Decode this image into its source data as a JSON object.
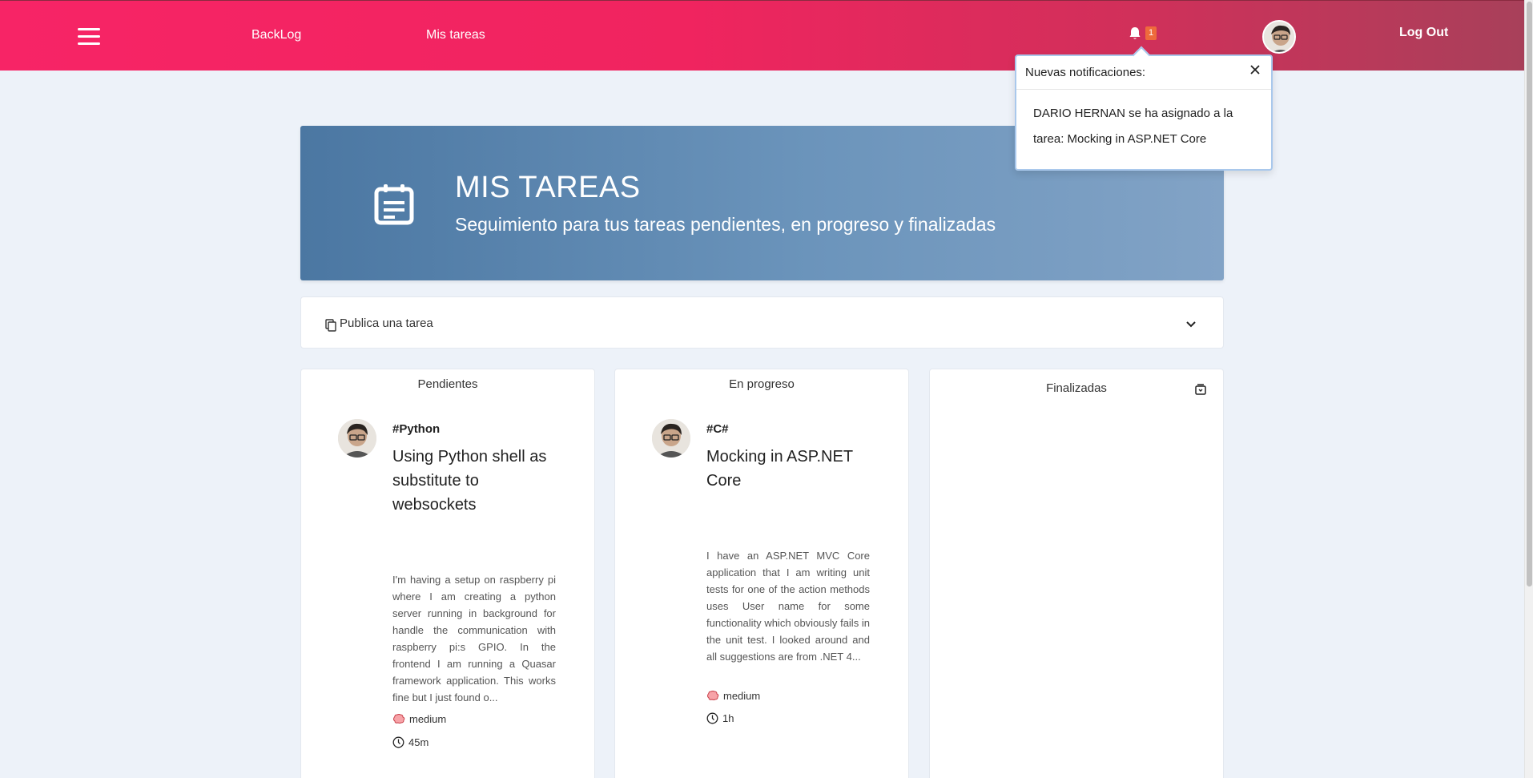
{
  "nav": {
    "backlog_label": "BackLog",
    "mytasks_label": "Mis tareas",
    "notification_count": "1",
    "logout_label": "Log Out"
  },
  "notifications": {
    "title": "Nuevas notificaciones:",
    "message_prefix": "DARIO HERNAN se ha asignado a la tarea: ",
    "message_task": "Mocking in ASP.NET Core"
  },
  "hero": {
    "title": "MIS TAREAS",
    "subtitle": "Seguimiento para tus tareas pendientes, en progreso y finalizadas"
  },
  "publish": {
    "label": "Publica una tarea"
  },
  "columns": [
    {
      "title": "Pendientes",
      "tasks": [
        {
          "tag": "#Python",
          "title": "Using Python shell as substitute to websockets",
          "description": "I'm having a setup on raspberry pi where I am creating a python server running in background for handle the communication with raspberry pi:s GPIO. In the frontend I am running a Quasar framework application. This works fine but I just found o...",
          "difficulty": "medium",
          "time": "45m"
        }
      ]
    },
    {
      "title": "En progreso",
      "tasks": [
        {
          "tag": "#C#",
          "title": "Mocking in ASP.NET Core",
          "description": "I have an ASP.NET MVC Core application that I am writing unit tests for one of the action methods uses User name for some functionality which obviously fails in the unit test. I looked around and all suggestions are from .NET 4...",
          "difficulty": "medium",
          "time": "1h"
        }
      ]
    },
    {
      "title": "Finalizadas",
      "tasks": []
    }
  ],
  "colors": {
    "navbar_start": "#f72466",
    "navbar_end": "#a8405a",
    "hero_start": "#4b77a2",
    "hero_end": "#82a3c6",
    "badge": "#ee6a3c",
    "page_bg": "#edf2f9"
  },
  "icons": {
    "menu": "hamburger-icon",
    "bell": "bell-icon",
    "hero": "calendar-note-icon",
    "publish": "copy-icon",
    "chevron": "chevron-down-icon",
    "archive": "archive-icon",
    "difficulty": "brain-icon",
    "time": "clock-icon",
    "close": "close-icon"
  }
}
